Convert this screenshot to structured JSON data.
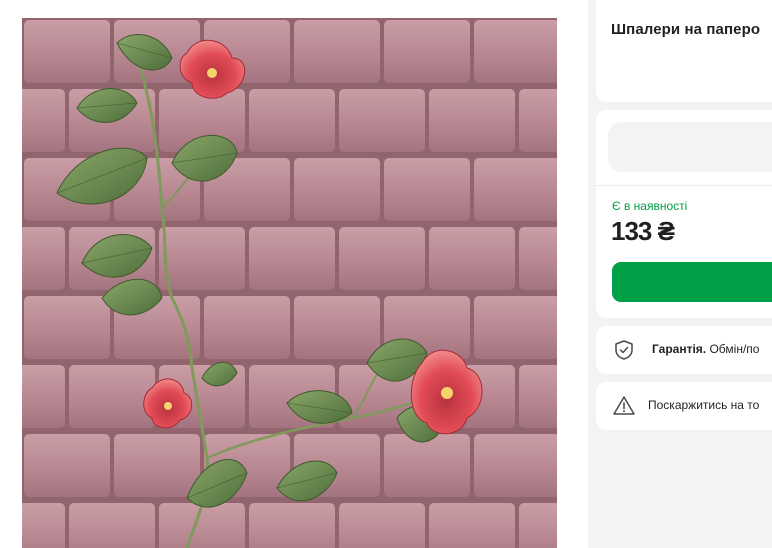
{
  "product": {
    "title": "Шпалери на паперо",
    "image_alt": "Wallpaper with pink brick pattern and climbing red flowers"
  },
  "purchase": {
    "availability": "Є в наявності",
    "price": "133 ₴"
  },
  "warranty": {
    "label": "Гарантія.",
    "text": " Обмін/по"
  },
  "report": {
    "text": "Поскаржитись на то"
  },
  "icons": {
    "warranty": "shield-check-icon",
    "report": "warning-triangle-icon"
  },
  "colors": {
    "accent_green": "#00a046",
    "brick": "#b7808b",
    "mortar": "#8e5e68",
    "flower": "#e24b55",
    "leaf": "#6b8a4e"
  }
}
